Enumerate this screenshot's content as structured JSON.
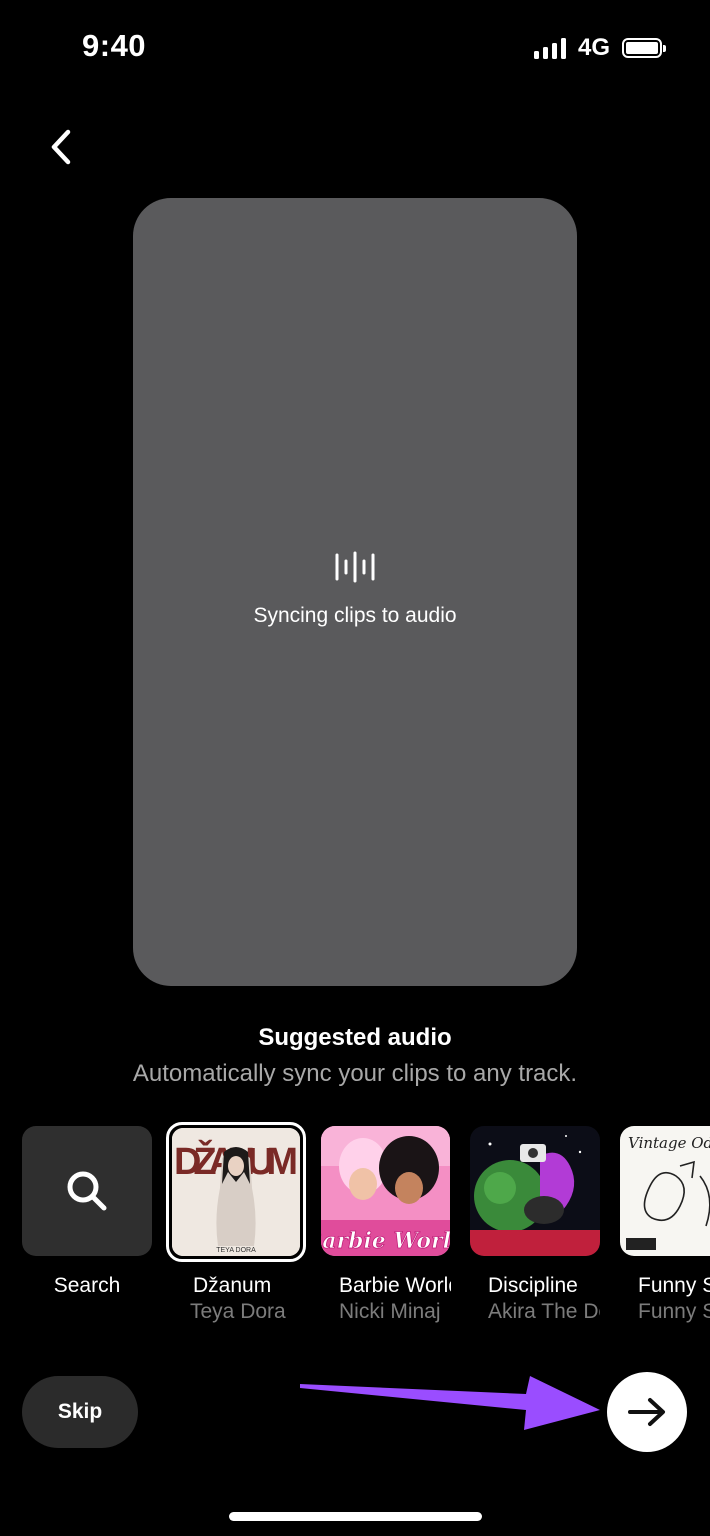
{
  "status_bar": {
    "time": "9:40",
    "network": "4G"
  },
  "preview": {
    "sync_text": "Syncing clips to audio"
  },
  "suggested": {
    "title": "Suggested audio",
    "subtitle": "Automatically sync your clips to any track."
  },
  "tracks": [
    {
      "label": "Search",
      "icon": "search-icon"
    },
    {
      "title": "Džanum",
      "artist": "Teya Dora",
      "art_text": "DŽANUM",
      "art_caption": "TEYA DORA"
    },
    {
      "title": "Barbie World",
      "artist": "Nicki Minaj",
      "art_text": "Barbie World"
    },
    {
      "title": "Discipline",
      "artist": "Akira The Don"
    },
    {
      "title": "Funny Song",
      "artist": "Funny Song",
      "art_text": "Vintage Odd"
    }
  ],
  "actions": {
    "skip_label": "Skip",
    "next_icon": "arrow-right-icon"
  },
  "colors": {
    "background": "#000000",
    "preview_card": "#5a5a5c",
    "annotation": "#9a4dff"
  }
}
